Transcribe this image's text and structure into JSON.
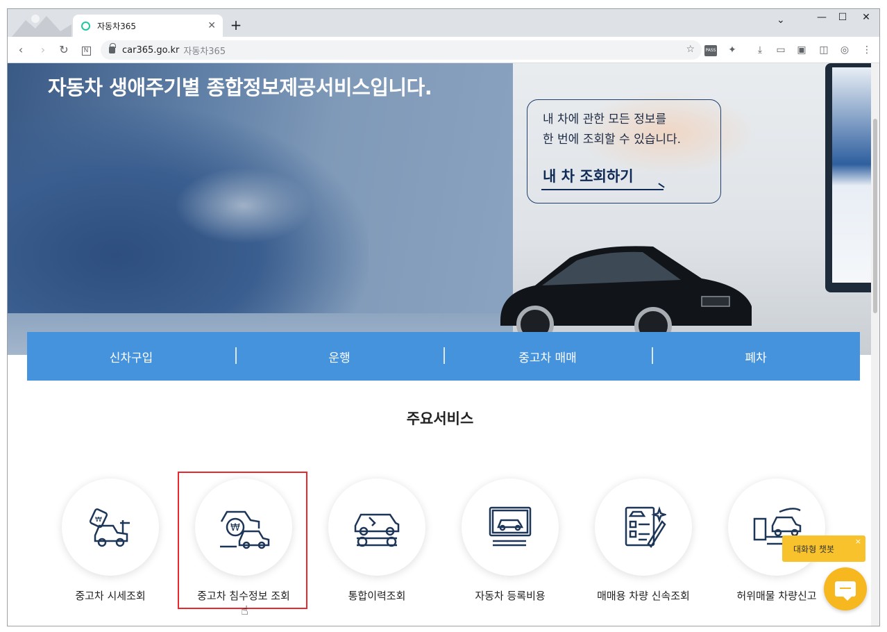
{
  "browser": {
    "tab_title": "자동차365",
    "tab_close": "✕",
    "new_tab": "+",
    "tab_search": "⌄",
    "minimize": "—",
    "maximize": "☐",
    "close": "✕",
    "url_domain": "car365.go.kr",
    "url_title": "자동차365",
    "pass_icon_text": "PASS"
  },
  "hero": {
    "headline": "자동차 생애주기별 종합정보제공서비스입니다.",
    "cta_line1": "내 차에 관한 모든 정보를",
    "cta_line2": "한 번에 조회할 수 있습니다.",
    "cta_link": "내 차 조회하기"
  },
  "categories": [
    "신차구입",
    "운행",
    "중고차 매매",
    "폐차"
  ],
  "section_title": "주요서비스",
  "services": [
    {
      "label": "중고차 시세조회",
      "icon": "car-price-tag-icon"
    },
    {
      "label": "중고차 침수정보 조회",
      "icon": "car-flood-won-icon"
    },
    {
      "label": "통합이력조회",
      "icon": "car-repair-wrench-icon"
    },
    {
      "label": "자동차 등록비용",
      "icon": "car-monitor-icon"
    },
    {
      "label": "매매용 차량 신속조회",
      "icon": "car-document-pen-icon"
    },
    {
      "label": "허위매물 차량신고",
      "icon": "car-tow-truck-icon"
    }
  ],
  "chatbot": {
    "tooltip": "대화형 챗봇",
    "tooltip_close": "×"
  },
  "colors": {
    "accent": "#4593dc",
    "icon_navy": "#1d3557",
    "chat_yellow": "#f7c22b",
    "highlight_red": "#e8282d"
  }
}
